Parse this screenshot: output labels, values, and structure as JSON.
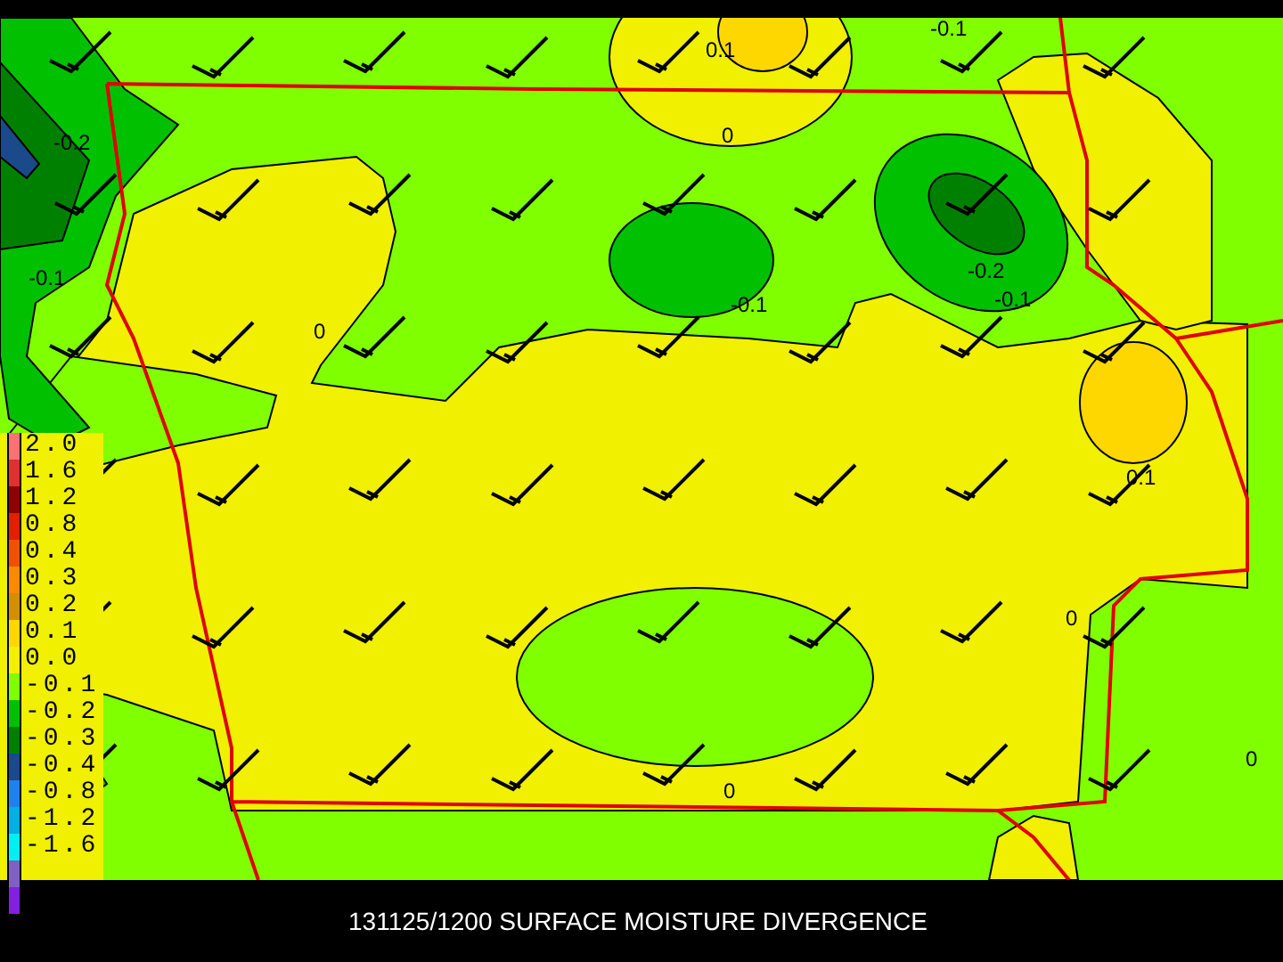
{
  "map": {
    "contour_labels": [
      {
        "text": "0.1"
      },
      {
        "text": "-0.1"
      },
      {
        "text": "-0.2"
      },
      {
        "text": "0"
      },
      {
        "text": "-0.1"
      },
      {
        "text": "0"
      },
      {
        "text": "-0.1"
      },
      {
        "text": "-0.2"
      },
      {
        "text": "-0.1"
      },
      {
        "text": "0.1"
      },
      {
        "text": "0"
      },
      {
        "text": "0"
      },
      {
        "text": "0"
      }
    ]
  },
  "legend": [
    {
      "label": "2.0",
      "color": "#ff7070"
    },
    {
      "label": "1.6",
      "color": "#e03030"
    },
    {
      "label": "1.2",
      "color": "#900000"
    },
    {
      "label": "0.8",
      "color": "#e02000"
    },
    {
      "label": "0.4",
      "color": "#f05000"
    },
    {
      "label": "0.3",
      "color": "#ff8800"
    },
    {
      "label": "0.2",
      "color": "#d09000"
    },
    {
      "label": "0.1",
      "color": "#ffd700"
    },
    {
      "label": "0.0",
      "color": "#f0f000"
    },
    {
      "label": "-0.1",
      "color": "#80ff00"
    },
    {
      "label": "-0.2",
      "color": "#00c000"
    },
    {
      "label": "-0.3",
      "color": "#008000"
    },
    {
      "label": "-0.4",
      "color": "#1a4a8a"
    },
    {
      "label": "-0.8",
      "color": "#2080f0"
    },
    {
      "label": "-1.2",
      "color": "#00b0e0"
    },
    {
      "label": "-1.6",
      "color": "#00f0f0"
    },
    {
      "color": "#8060c0"
    },
    {
      "color": "#8020e0"
    }
  ],
  "title": "131125/1200 SURFACE MOISTURE DIVERGENCE"
}
